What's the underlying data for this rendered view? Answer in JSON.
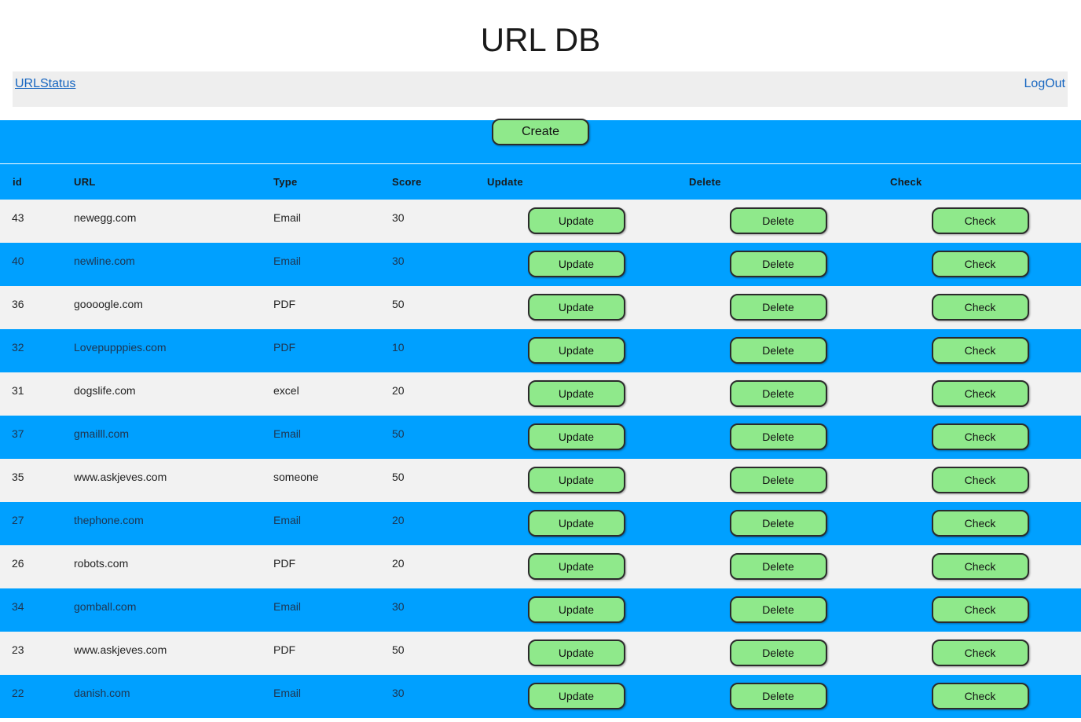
{
  "title": "URL DB",
  "nav": {
    "left_link": "URLStatus",
    "right_link": "LogOut"
  },
  "create_label": "Create",
  "table": {
    "headers": [
      "id",
      "URL",
      "Type",
      "Score",
      "Update",
      "Delete",
      "Check"
    ],
    "rows": [
      {
        "id": "43",
        "url": "newegg.com",
        "type": "Email",
        "score": "30",
        "update": "Update",
        "delete": "Delete",
        "check": "Check"
      },
      {
        "id": "40",
        "url": "newline.com",
        "type": "Email",
        "score": "30",
        "update": "Update",
        "delete": "Delete",
        "check": "Check"
      },
      {
        "id": "36",
        "url": "goooogle.com",
        "type": "PDF",
        "score": "50",
        "update": "Update",
        "delete": "Delete",
        "check": "Check"
      },
      {
        "id": "32",
        "url": "Lovepupppies.com",
        "type": "PDF",
        "score": "10",
        "update": "Update",
        "delete": "Delete",
        "check": "Check"
      },
      {
        "id": "31",
        "url": "dogslife.com",
        "type": "excel",
        "score": "20",
        "update": "Update",
        "delete": "Delete",
        "check": "Check"
      },
      {
        "id": "37",
        "url": "gmailll.com",
        "type": "Email",
        "score": "50",
        "update": "Update",
        "delete": "Delete",
        "check": "Check"
      },
      {
        "id": "35",
        "url": "www.askjeves.com",
        "type": "someone",
        "score": "50",
        "update": "Update",
        "delete": "Delete",
        "check": "Check"
      },
      {
        "id": "27",
        "url": "thephone.com",
        "type": "Email",
        "score": "20",
        "update": "Update",
        "delete": "Delete",
        "check": "Check"
      },
      {
        "id": "26",
        "url": "robots.com",
        "type": "PDF",
        "score": "20",
        "update": "Update",
        "delete": "Delete",
        "check": "Check"
      },
      {
        "id": "34",
        "url": "gomball.com",
        "type": "Email",
        "score": "30",
        "update": "Update",
        "delete": "Delete",
        "check": "Check"
      },
      {
        "id": "23",
        "url": "www.askjeves.com",
        "type": "PDF",
        "score": "50",
        "update": "Update",
        "delete": "Delete",
        "check": "Check"
      },
      {
        "id": "22",
        "url": "danish.com",
        "type": "Email",
        "score": "30",
        "update": "Update",
        "delete": "Delete",
        "check": "Check"
      }
    ]
  },
  "colors": {
    "accent_blue": "#00a0ff",
    "button_green": "#8fe98b",
    "row_light": "#f2f2f2",
    "nav_bg": "#eeeeee",
    "link_blue": "#1565c0"
  }
}
